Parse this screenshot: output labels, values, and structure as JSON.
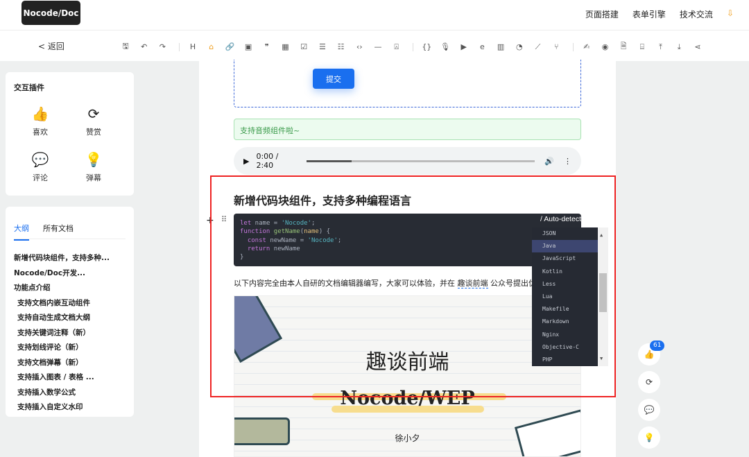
{
  "header": {
    "logo": "Nocode/Doc",
    "nav": [
      "页面搭建",
      "表单引擎",
      "技术交流"
    ],
    "nav_mark": "⇩"
  },
  "toolbar": {
    "back": "< 返回",
    "icons": [
      {
        "name": "save-icon",
        "g": "🖫"
      },
      {
        "name": "undo-icon",
        "g": "↶"
      },
      {
        "name": "redo-icon",
        "g": "↷"
      },
      {
        "sep": true
      },
      {
        "name": "heading-icon",
        "g": "H"
      },
      {
        "name": "highlight-icon",
        "g": "⌂",
        "active": true
      },
      {
        "name": "link-icon",
        "g": "🔗"
      },
      {
        "name": "image-icon",
        "g": "▣"
      },
      {
        "name": "quote-icon",
        "g": "❞"
      },
      {
        "name": "table-icon",
        "g": "▦"
      },
      {
        "name": "checkbox-icon",
        "g": "☑"
      },
      {
        "name": "ordered-list-icon",
        "g": "☰"
      },
      {
        "name": "bullet-list-icon",
        "g": "☷"
      },
      {
        "name": "code-inline-icon",
        "g": "‹›"
      },
      {
        "name": "divider-icon",
        "g": "—"
      },
      {
        "name": "alarm-icon",
        "g": "⍓"
      },
      {
        "sep": true
      },
      {
        "name": "code-block-icon",
        "g": "{}"
      },
      {
        "name": "microphone-icon",
        "g": "🎙"
      },
      {
        "name": "video-icon",
        "g": "▶"
      },
      {
        "name": "browser-icon",
        "g": "e"
      },
      {
        "name": "bar-chart-icon",
        "g": "▥"
      },
      {
        "name": "pie-chart-icon",
        "g": "◔"
      },
      {
        "name": "line-chart-icon",
        "g": "⟋"
      },
      {
        "name": "branch-icon",
        "g": "⑂"
      },
      {
        "sep": true
      },
      {
        "name": "sign-icon",
        "g": "✍"
      },
      {
        "name": "preview-icon",
        "g": "◉"
      },
      {
        "name": "markdown-file-icon",
        "g": "🗎"
      },
      {
        "name": "clean-icon",
        "g": "⌸"
      },
      {
        "name": "upload-icon",
        "g": "⤒"
      },
      {
        "name": "download-icon",
        "g": "⤓"
      },
      {
        "name": "share-icon",
        "g": "⋖"
      }
    ]
  },
  "plugins": {
    "title": "交互插件",
    "items": [
      {
        "label": "喜欢",
        "icon": "👍"
      },
      {
        "label": "赞赏",
        "icon": "⟳"
      },
      {
        "label": "评论",
        "icon": "💬"
      },
      {
        "label": "弹幕",
        "icon": "💡"
      }
    ]
  },
  "outline": {
    "tabs": [
      "大纲",
      "所有文档"
    ],
    "items": [
      {
        "t": "新增代码块组件，支持多种...",
        "sub": false
      },
      {
        "t": "Nocode/Doc开发...",
        "sub": false
      },
      {
        "t": "功能点介绍",
        "sub": false
      },
      {
        "t": "支持文档内嵌互动组件",
        "sub": true
      },
      {
        "t": "支持自动生成文档大纲",
        "sub": true
      },
      {
        "t": "支持关键词注释（新）",
        "sub": true
      },
      {
        "t": "支持划线评论（新）",
        "sub": true
      },
      {
        "t": "支持文档弹幕（新）",
        "sub": true
      },
      {
        "t": "支持插入图表 / 表格 ...",
        "sub": true
      },
      {
        "t": "支持插入数学公式",
        "sub": true
      },
      {
        "t": "支持插入自定义水印",
        "sub": true
      }
    ]
  },
  "doc": {
    "submit": "提交",
    "notice": "支持音频组件啦~",
    "audio_time": "0:00 / 2:40",
    "audio_progress": 0.2,
    "heading": "新增代码块组件，支持多种编程语言",
    "code_lang": "/ Auto-detect",
    "para_pre": "以下内容完全由本人自研的文档编辑器编写，大家可以体验，并在 ",
    "para_link": "趣谈前端",
    "para_post": " 公众号提出优化建议",
    "image": {
      "title": "趣谈前端",
      "subtitle": "Nocode/WEP",
      "author": "徐小夕"
    }
  },
  "languages": [
    "JSON",
    "Java",
    "JavaScript",
    "Kotlin",
    "Less",
    "Lua",
    "Makefile",
    "Markdown",
    "Nginx",
    "Objective-C",
    "PHP"
  ],
  "selected_language": "Java",
  "fab": {
    "like_count": "61"
  }
}
